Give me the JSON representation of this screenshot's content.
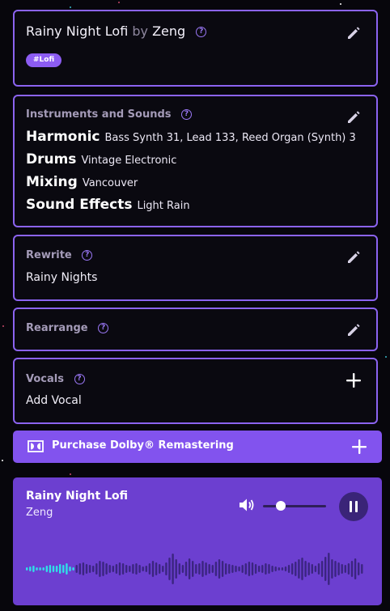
{
  "song": {
    "title": "Rainy Night Lofi",
    "by": "by",
    "artist": "Zeng",
    "tag": "#Lofi"
  },
  "instruments": {
    "label": "Instruments and Sounds",
    "rows": [
      {
        "name": "Harmonic",
        "value": "Bass Synth 31, Lead 133, Reed Organ (Synth) 3"
      },
      {
        "name": "Drums",
        "value": "Vintage Electronic"
      },
      {
        "name": "Mixing",
        "value": "Vancouver"
      },
      {
        "name": "Sound Effects",
        "value": "Light Rain"
      }
    ]
  },
  "rewrite": {
    "label": "Rewrite",
    "value": "Rainy Nights"
  },
  "rearrange": {
    "label": "Rearrange"
  },
  "vocals": {
    "label": "Vocals",
    "value": "Add Vocal"
  },
  "dolby": {
    "label": "Purchase Dolby® Remastering"
  },
  "player": {
    "title": "Rainy Night Lofi",
    "artist": "Zeng",
    "volume": 0.3,
    "progress": 0.15,
    "state": "playing"
  },
  "colors": {
    "accent": "#8b63f0",
    "player_bg": "#6c3fd0",
    "played": "#2fe0e8",
    "unplayed": "#3b2580"
  },
  "icons": [
    "help-icon",
    "edit-icon",
    "plus-icon",
    "dolby-icon",
    "volume-icon",
    "pause-icon"
  ]
}
